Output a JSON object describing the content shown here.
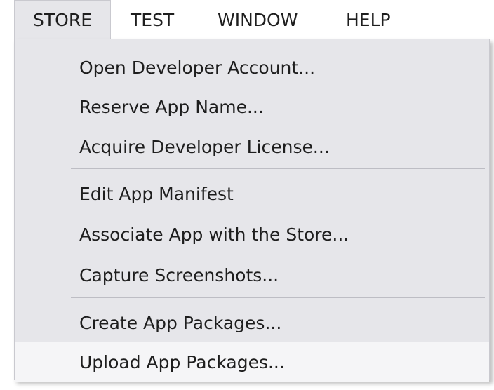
{
  "menubar": {
    "items": [
      {
        "label": "STORE",
        "active": true
      },
      {
        "label": "TEST"
      },
      {
        "label": "WINDOW"
      },
      {
        "label": "HELP"
      }
    ]
  },
  "store_menu": {
    "groups": [
      {
        "items": [
          "Open Developer Account...",
          "Reserve App Name...",
          "Acquire Developer License..."
        ]
      },
      {
        "items": [
          "Edit App Manifest",
          "Associate App with the Store...",
          "Capture Screenshots..."
        ]
      },
      {
        "items": [
          "Create App Packages...",
          "Upload App Packages..."
        ]
      }
    ],
    "highlighted_item": "Upload App Packages..."
  },
  "colors": {
    "menu_background": "#e6e6ea",
    "highlight": "#f5f5f7",
    "text": "#1e1e1e",
    "border": "#c9c9cf"
  }
}
